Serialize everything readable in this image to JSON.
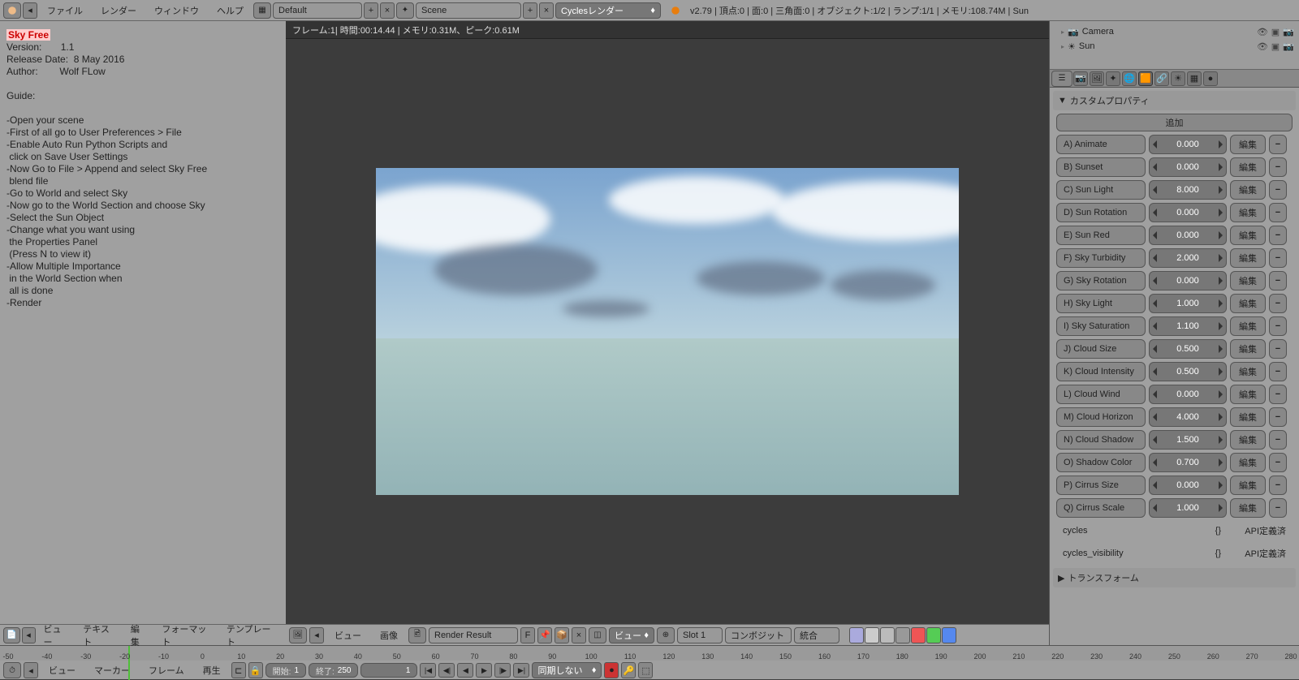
{
  "topbar": {
    "menus": [
      "ファイル",
      "レンダー",
      "ウィンドウ",
      "ヘルプ"
    ],
    "layout": "Default",
    "scene": "Scene",
    "engine": "Cyclesレンダー",
    "stats": "v2.79 | 頂点:0 | 面:0 | 三角面:0 | オブジェクト:1/2 | ランプ:1/1 | メモリ:108.74M | Sun"
  },
  "text_editor": {
    "title": "Sky Free",
    "body": "\nVersion:       1.1\nRelease Date:  8 May 2016\nAuthor:        Wolf FLow\n\nGuide:\n\n-Open your scene\n-First of all go to User Preferences > File\n-Enable Auto Run Python Scripts and\n click on Save User Settings\n-Now Go to File > Append and select Sky Free\n blend file\n-Go to World and select Sky\n-Now go to the World Section and choose Sky\n-Select the Sun Object\n-Change what you want using\n the Properties Panel\n (Press N to view it)\n-Allow Multiple Importance\n in the World Section when\n all is done\n-Render",
    "footer_menus": [
      "ビュー",
      "テキスト",
      "編集",
      "フォーマット",
      "テンプレート"
    ]
  },
  "render_view": {
    "header": "フレーム:1| 時間:00:14.44 | メモリ:0.31M、ピーク:0.61M",
    "footer_menus": [
      "ビュー",
      "画像"
    ],
    "image_name": "Render Result",
    "image_suffix": "F",
    "view_label": "ビュー",
    "slot": "Slot 1",
    "pass1": "コンボジット",
    "pass2": "統合"
  },
  "outliner": {
    "items": [
      {
        "name": "Camera"
      },
      {
        "name": "Sun"
      }
    ]
  },
  "props": {
    "panel_title": "カスタムプロパティ",
    "add_label": "追加",
    "edit_label": "編集",
    "rows": [
      {
        "name": "A) Animate",
        "val": "0.000"
      },
      {
        "name": "B) Sunset",
        "val": "0.000"
      },
      {
        "name": "C) Sun Light",
        "val": "8.000"
      },
      {
        "name": "D) Sun Rotation",
        "val": "0.000"
      },
      {
        "name": "E) Sun Red",
        "val": "0.000"
      },
      {
        "name": "F) Sky Turbidity",
        "val": "2.000"
      },
      {
        "name": "G) Sky Rotation",
        "val": "0.000"
      },
      {
        "name": "H) Sky Light",
        "val": "1.000"
      },
      {
        "name": "I) Sky Saturation",
        "val": "1.100"
      },
      {
        "name": "J) Cloud Size",
        "val": "0.500"
      },
      {
        "name": "K) Cloud Intensity",
        "val": "0.500"
      },
      {
        "name": "L) Cloud Wind",
        "val": "0.000"
      },
      {
        "name": "M) Cloud Horizon",
        "val": "4.000"
      },
      {
        "name": "N) Cloud Shadow",
        "val": "1.500"
      },
      {
        "name": "O) Shadow Color",
        "val": "0.700"
      },
      {
        "name": "P) Cirrus Size",
        "val": "0.000"
      },
      {
        "name": "Q) Cirrus Scale",
        "val": "1.000"
      }
    ],
    "extra": [
      {
        "k": "cycles",
        "b": "{}",
        "a": "API定義済"
      },
      {
        "k": "cycles_visibility",
        "b": "{}",
        "a": "API定義済"
      }
    ],
    "transform_header": "トランスフォーム"
  },
  "timeline": {
    "ticks": [
      "-50",
      "-40",
      "-30",
      "-20",
      "-10",
      "0",
      "10",
      "20",
      "30",
      "40",
      "50",
      "60",
      "70",
      "80",
      "90",
      "100",
      "110",
      "120",
      "130",
      "140",
      "150",
      "160",
      "170",
      "180",
      "190",
      "200",
      "210",
      "220",
      "230",
      "240",
      "250",
      "260",
      "270",
      "280"
    ],
    "menus": [
      "ビュー",
      "マーカー",
      "フレーム",
      "再生"
    ],
    "start_label": "開始:",
    "start_val": "1",
    "end_label": "終了:",
    "end_val": "250",
    "current": "1",
    "sync": "同期しない"
  }
}
